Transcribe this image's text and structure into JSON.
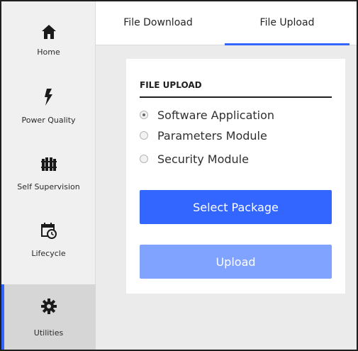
{
  "sidebar": {
    "items": [
      {
        "label": "Home",
        "icon": "home-icon"
      },
      {
        "label": "Power Quality",
        "icon": "lightning-icon"
      },
      {
        "label": "Self Supervision",
        "icon": "fence-icon"
      },
      {
        "label": "Lifecycle",
        "icon": "calendar-clock-icon"
      },
      {
        "label": "Utilities",
        "icon": "gear-icon",
        "active": true
      }
    ]
  },
  "tabs": [
    {
      "label": "File Download"
    },
    {
      "label": "File Upload",
      "active": true
    }
  ],
  "upload": {
    "title": "FILE UPLOAD",
    "options": [
      {
        "label": "Software Application",
        "checked": true
      },
      {
        "label": "Parameters Module",
        "checked": false
      },
      {
        "label": "Security Module",
        "checked": false
      }
    ],
    "select_button": "Select Package",
    "upload_button": "Upload"
  },
  "colors": {
    "accent": "#3366ff",
    "accent_disabled": "#7fa3ff",
    "sidebar_bg": "#f0f0f0",
    "sidebar_active_bg": "#d6d6d6",
    "content_bg": "#ebebeb"
  }
}
